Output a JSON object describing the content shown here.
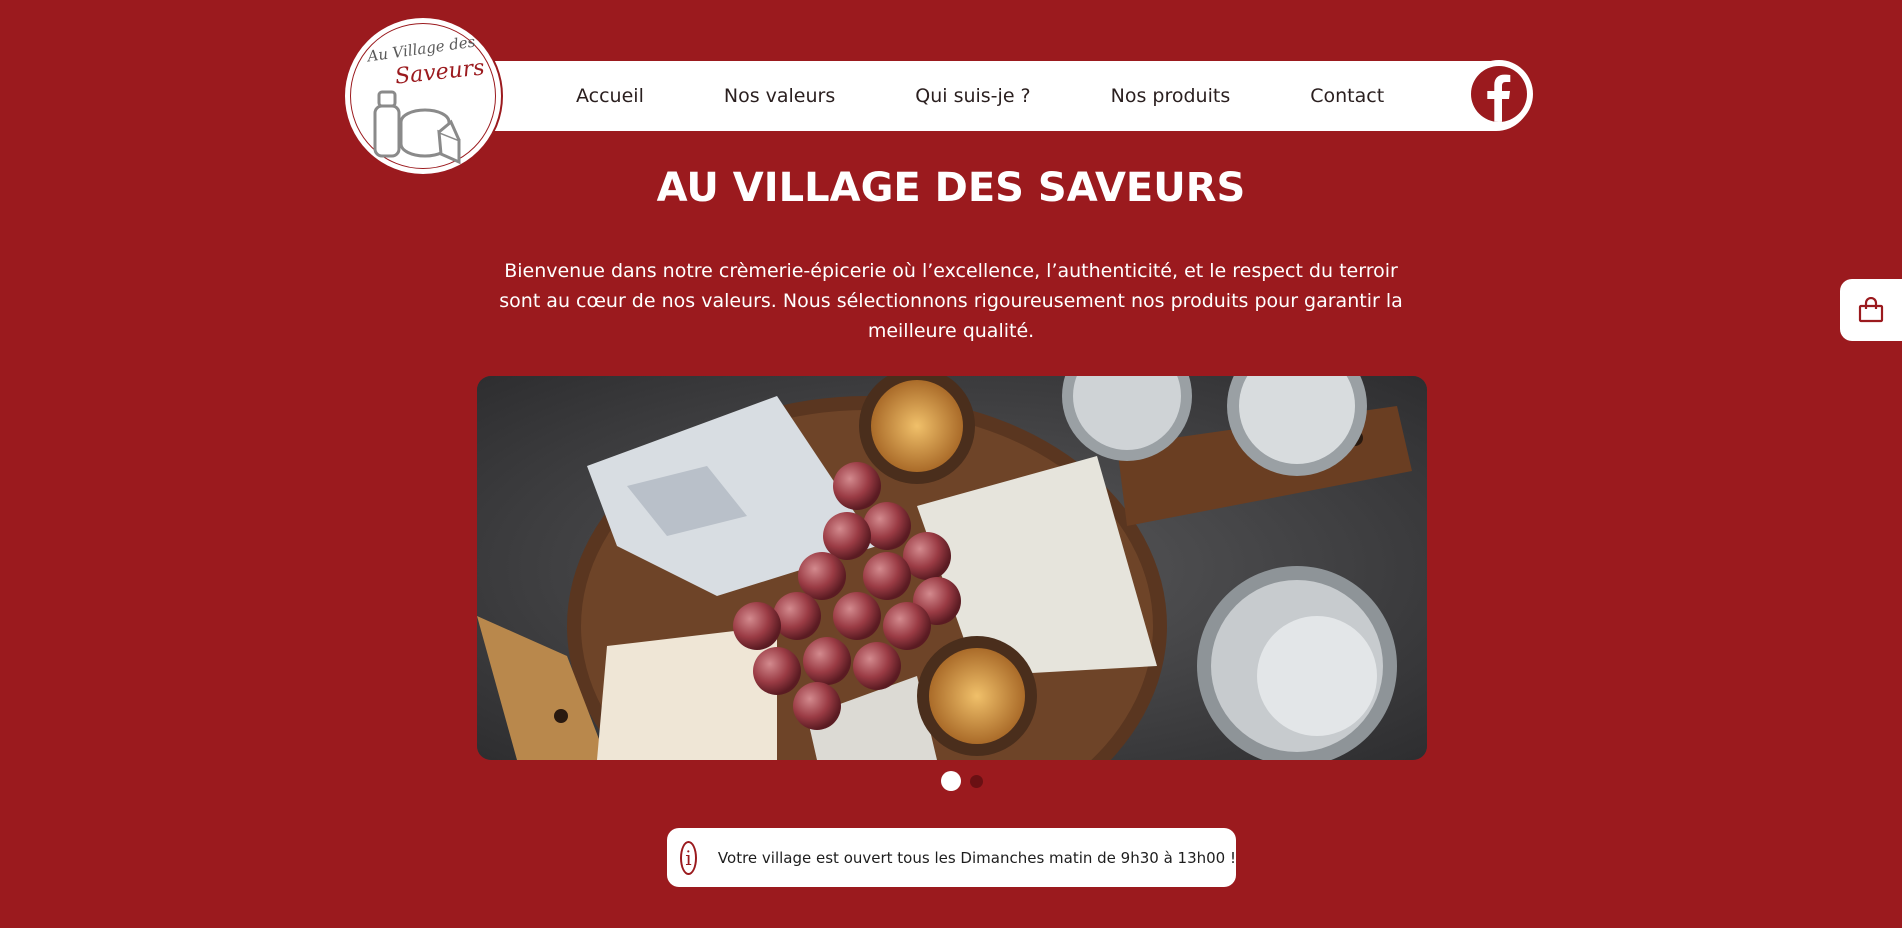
{
  "logo": {
    "line1": "Au Village des",
    "line2": "Saveurs"
  },
  "nav": {
    "items": [
      {
        "label": "Accueil"
      },
      {
        "label": "Nos valeurs"
      },
      {
        "label": "Qui suis-je ?"
      },
      {
        "label": "Nos produits"
      },
      {
        "label": "Contact"
      }
    ],
    "social_icon": "facebook-icon"
  },
  "hero": {
    "title": "AU VILLAGE DES SAVEURS",
    "intro": "Bienvenue dans notre crèmerie-épicerie où l’excellence, l’authenticité, et le respect du terroir sont au cœur de nos valeurs. Nous sélectionnons rigoureusement nos produits pour garantir la meilleure qualité."
  },
  "carousel": {
    "slide_count": 2,
    "active_index": 0
  },
  "info": {
    "icon": "info-icon",
    "text": "Votre village est ouvert tous les Dimanches matin de 9h30 à 13h00 !"
  },
  "cart": {
    "icon": "shopping-bag-icon"
  },
  "colors": {
    "brand": "#9b1a1e",
    "text_dark": "#1e1e1e",
    "white": "#ffffff"
  }
}
